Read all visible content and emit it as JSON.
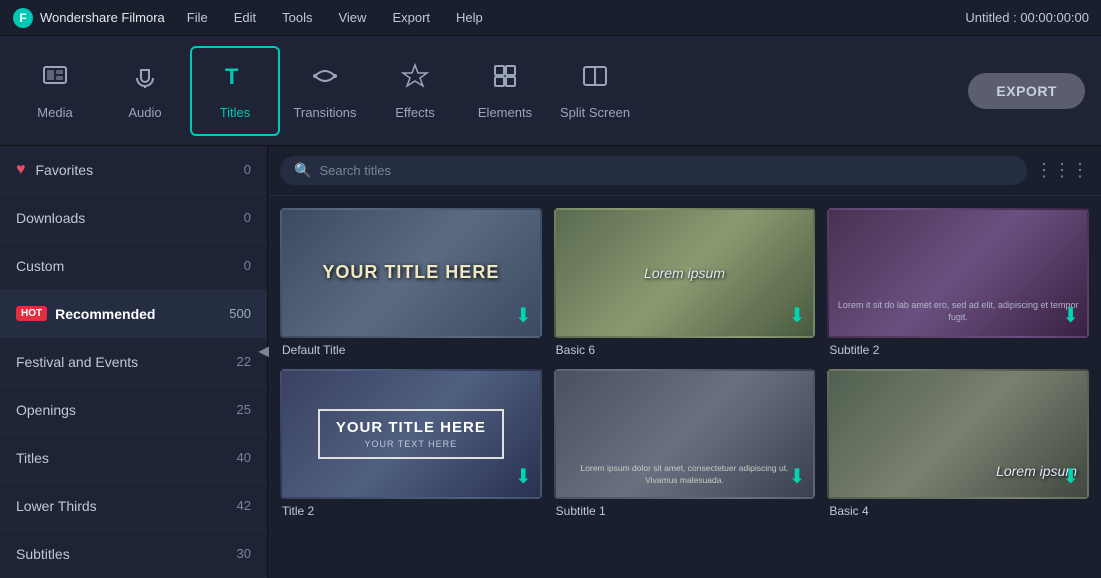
{
  "titleBar": {
    "appName": "Wondershare Filmora",
    "menuItems": [
      "File",
      "Edit",
      "Tools",
      "View",
      "Export",
      "Help"
    ],
    "projectTitle": "Untitled : 00:00:00:00"
  },
  "toolbar": {
    "tools": [
      {
        "id": "media",
        "label": "Media",
        "icon": "☰",
        "active": false
      },
      {
        "id": "audio",
        "label": "Audio",
        "icon": "♪",
        "active": false
      },
      {
        "id": "titles",
        "label": "Titles",
        "icon": "T",
        "active": true
      },
      {
        "id": "transitions",
        "label": "Transitions",
        "icon": "↔",
        "active": false
      },
      {
        "id": "effects",
        "label": "Effects",
        "icon": "✦",
        "active": false
      },
      {
        "id": "elements",
        "label": "Elements",
        "icon": "❖",
        "active": false
      },
      {
        "id": "splitscreen",
        "label": "Split Screen",
        "icon": "▣",
        "active": false
      }
    ],
    "exportLabel": "EXPORT"
  },
  "sidebar": {
    "items": [
      {
        "id": "favorites",
        "label": "Favorites",
        "count": "0",
        "icon": "heart",
        "hot": false
      },
      {
        "id": "downloads",
        "label": "Downloads",
        "count": "0",
        "icon": null,
        "hot": false
      },
      {
        "id": "custom",
        "label": "Custom",
        "count": "0",
        "icon": null,
        "hot": false
      },
      {
        "id": "recommended",
        "label": "Recommended",
        "count": "500",
        "icon": null,
        "hot": true,
        "active": true
      },
      {
        "id": "festival",
        "label": "Festival and Events",
        "count": "22",
        "icon": null,
        "hot": false
      },
      {
        "id": "openings",
        "label": "Openings",
        "count": "25",
        "icon": null,
        "hot": false
      },
      {
        "id": "titles",
        "label": "Titles",
        "count": "40",
        "icon": null,
        "hot": false
      },
      {
        "id": "lowerthirds",
        "label": "Lower Thirds",
        "count": "42",
        "icon": null,
        "hot": false
      },
      {
        "id": "subtitles",
        "label": "Subtitles",
        "count": "30",
        "icon": null,
        "hot": false
      }
    ]
  },
  "searchBar": {
    "placeholder": "Search titles"
  },
  "grid": {
    "items": [
      {
        "id": "default-title",
        "label": "Default Title",
        "thumbType": "default"
      },
      {
        "id": "basic-6",
        "label": "Basic 6",
        "thumbType": "basic6"
      },
      {
        "id": "subtitle-2",
        "label": "Subtitle 2",
        "thumbType": "subtitle2"
      },
      {
        "id": "title-2",
        "label": "Title 2",
        "thumbType": "title2"
      },
      {
        "id": "subtitle-1",
        "label": "Subtitle 1",
        "thumbType": "subtitle1"
      },
      {
        "id": "basic-4",
        "label": "Basic 4",
        "thumbType": "basic4"
      }
    ]
  }
}
